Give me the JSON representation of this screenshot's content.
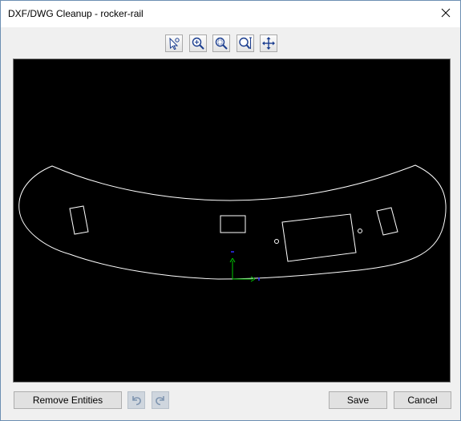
{
  "window": {
    "title": "DXF/DWG Cleanup - rocker-rail"
  },
  "toolbar": {
    "tools": [
      {
        "icon": "select-entities-icon"
      },
      {
        "icon": "zoom-icon"
      },
      {
        "icon": "zoom-window-icon"
      },
      {
        "icon": "zoom-fit-icon"
      },
      {
        "icon": "pan-icon"
      }
    ]
  },
  "canvas": {
    "background": "#000000",
    "entity_color": "#ffffff",
    "axis_x_color": "#00c800",
    "axis_y_color": "#00c800",
    "axis_end_color": "#3030ff"
  },
  "footer": {
    "remove_label": "Remove Entities",
    "undo_icon": "undo-icon",
    "redo_icon": "redo-icon",
    "save_label": "Save",
    "cancel_label": "Cancel"
  }
}
